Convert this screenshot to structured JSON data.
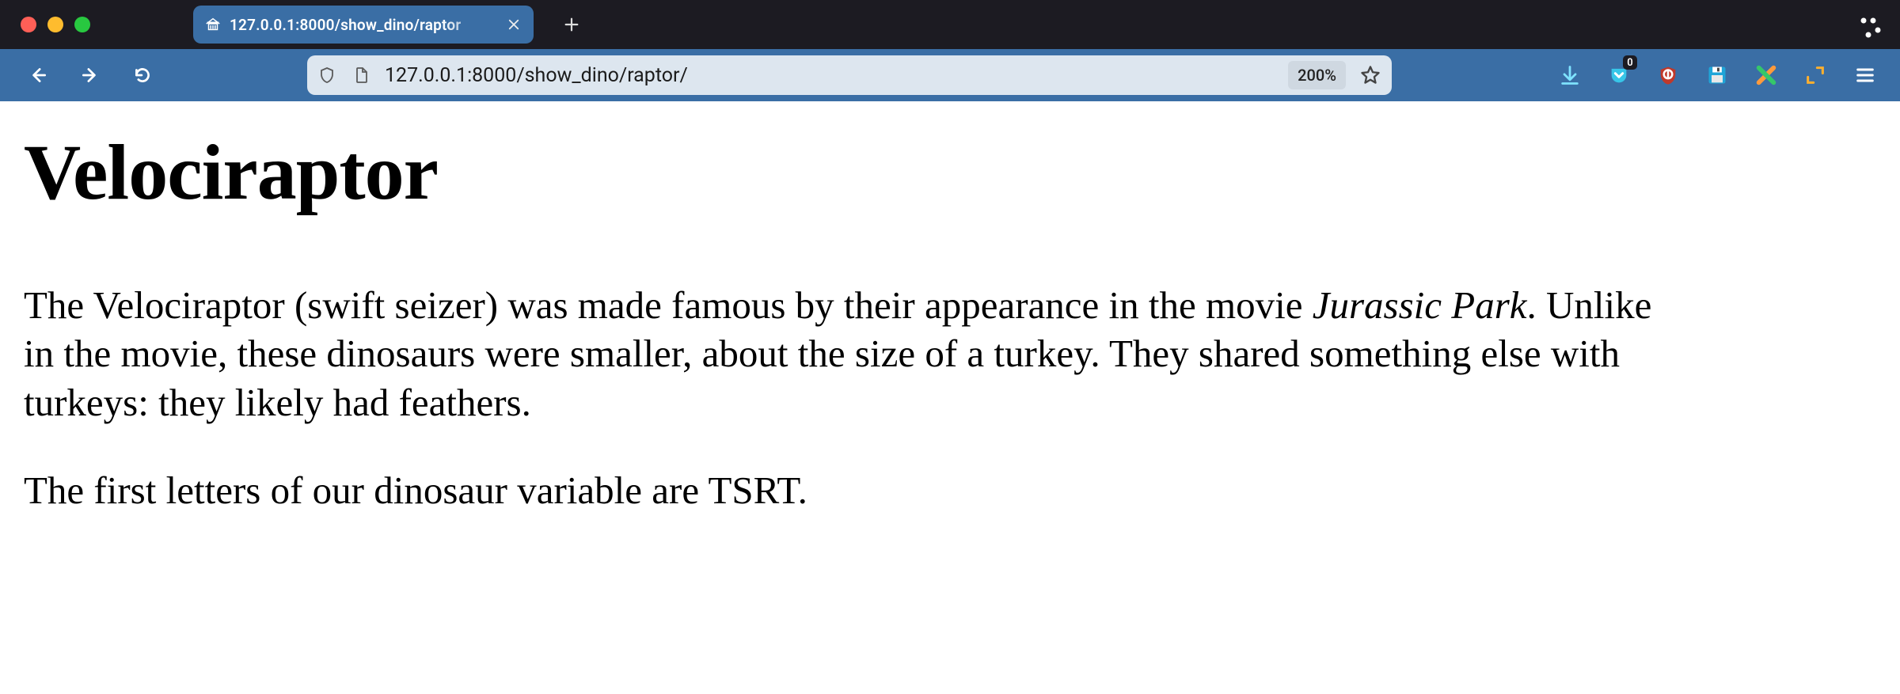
{
  "window": {
    "tab_title": "127.0.0.1:8000/show_dino/raptor"
  },
  "toolbar": {
    "url": "127.0.0.1:8000/show_dino/raptor/",
    "zoom": "200%",
    "pocket_badge": "0"
  },
  "content": {
    "heading": "Velociraptor",
    "para1_a": "The Velociraptor (swift seizer) was made famous by their appearance in the movie ",
    "para1_em": "Jurassic Park",
    "para1_b": ". Unlike in the movie, these dinosaurs were smaller, about the size of a turkey. They shared something else with turkeys: they likely had feathers.",
    "para2": "The first letters of our dinosaur variable are TSRT."
  }
}
